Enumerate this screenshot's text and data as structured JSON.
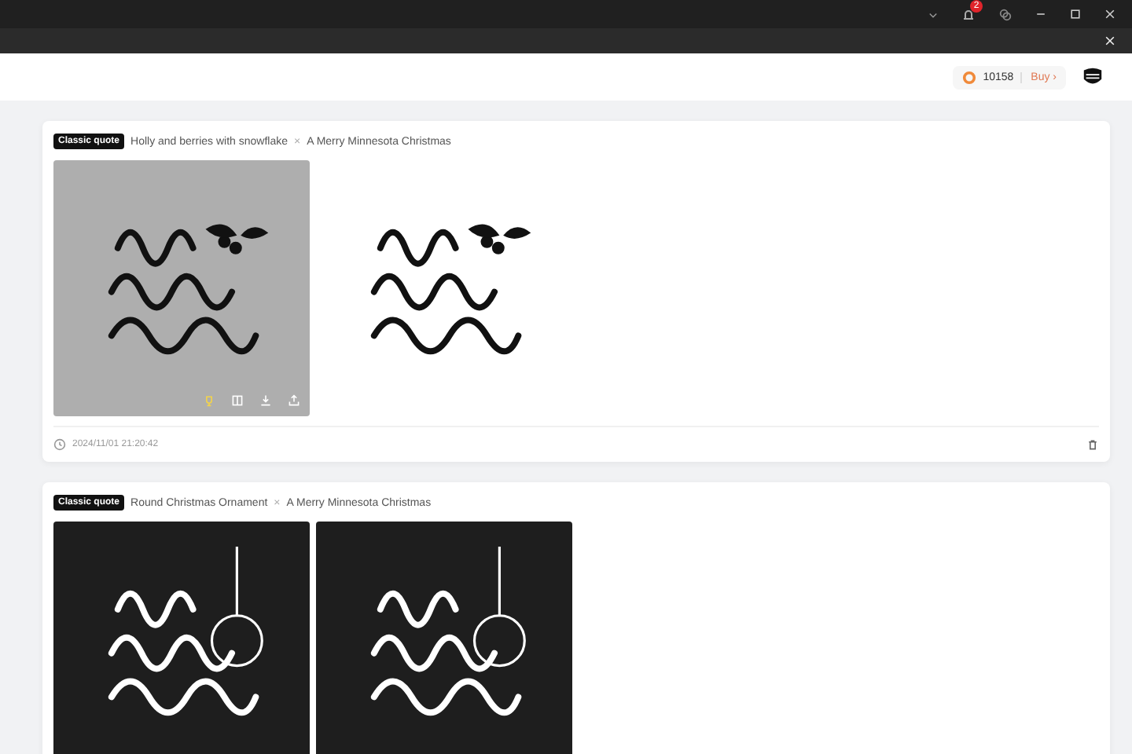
{
  "titlebar": {
    "notification_count": "2"
  },
  "header": {
    "coins": "10158",
    "buy": "Buy ›"
  },
  "cards": [
    {
      "tag": "Classic quote",
      "source": "Holly and berries with snowflake",
      "separator": "×",
      "title": "A Merry Minnesota Christmas",
      "images": [
        {
          "kind": "holly",
          "color": "#aeaeae",
          "hovered": true
        },
        {
          "kind": "holly",
          "color": "#ffffff",
          "hovered": false
        }
      ],
      "date": "2024/11/01 21:20:42"
    },
    {
      "tag": "Classic quote",
      "source": "Round Christmas Ornament",
      "separator": "×",
      "title": "A Merry Minnesota Christmas",
      "images": [
        {
          "kind": "ornament",
          "color": "#1e1e1e"
        },
        {
          "kind": "ornament",
          "color": "#1e1e1e"
        }
      ]
    }
  ]
}
